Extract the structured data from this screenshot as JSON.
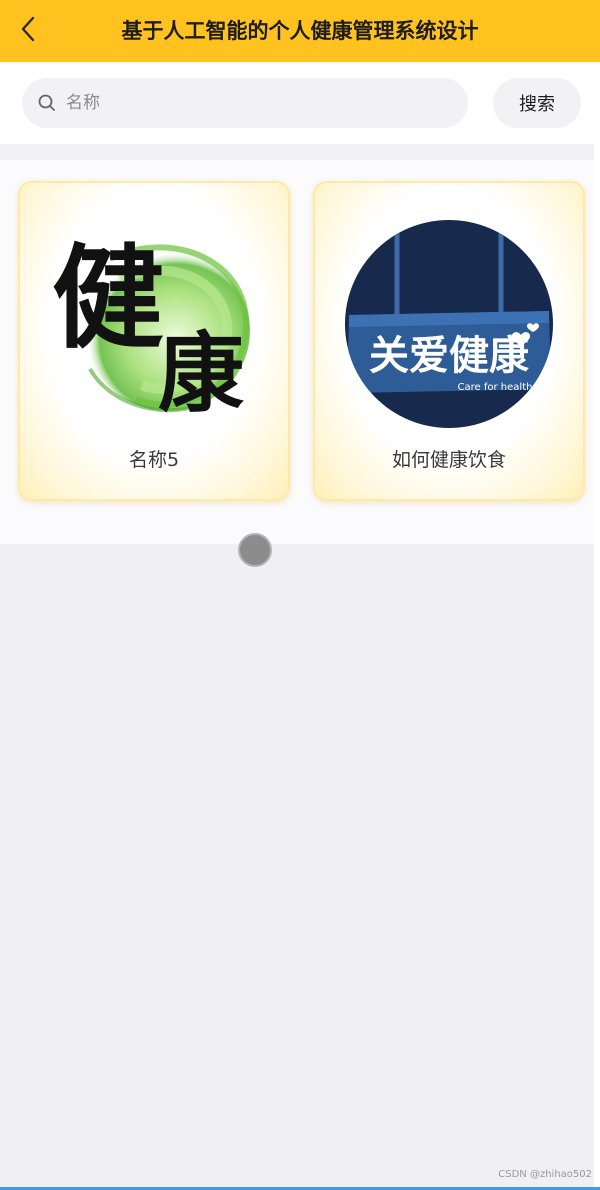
{
  "header": {
    "title": "基于人工智能的个人健康管理系统设计",
    "back_icon": "chevron-left-icon"
  },
  "search": {
    "placeholder": "名称",
    "value": "",
    "button_label": "搜索",
    "icon": "search-icon"
  },
  "cards": [
    {
      "label": "名称5",
      "image": "health-calligraphy-image",
      "image_text": [
        "健",
        "康"
      ]
    },
    {
      "label": "如何健康饮食",
      "image": "care-for-health-sign-image",
      "image_text": "关爱健康",
      "image_subtext": "Care for health"
    }
  ],
  "watermark": "CSDN @zhihao502",
  "colors": {
    "header_bg": "#ffc21f",
    "card_border": "#ffe9a3",
    "page_bg": "#f0eff1"
  }
}
